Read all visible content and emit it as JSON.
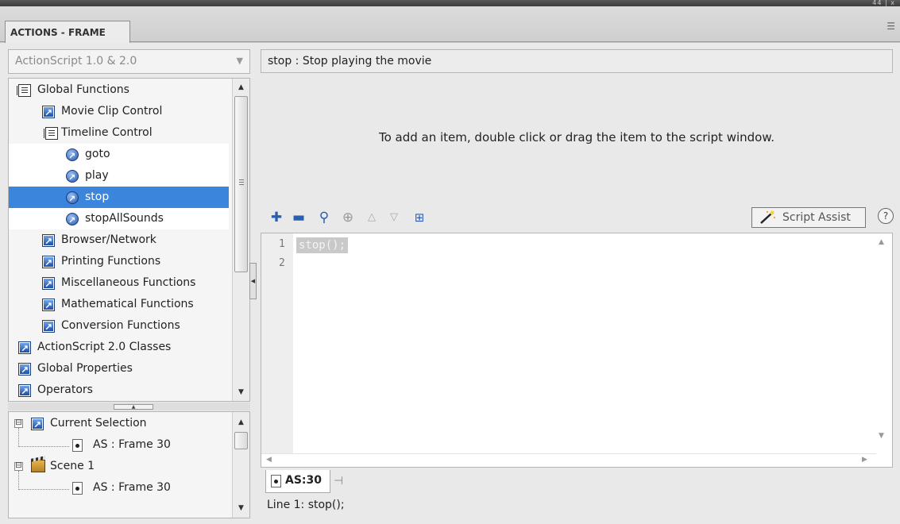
{
  "panel": {
    "tab_title": "ACTIONS - FRAME",
    "window_controls": "44 | x",
    "menu_icon": "panel-menu-icon"
  },
  "language_select": {
    "value": "ActionScript 1.0 & 2.0"
  },
  "actions_tree": {
    "items": [
      {
        "label": "Global Functions",
        "icon": "book-icon",
        "level": 0
      },
      {
        "label": "Movie Clip Control",
        "icon": "action-arrow-icon",
        "level": 1
      },
      {
        "label": "Timeline Control",
        "icon": "book-icon",
        "level": 1
      },
      {
        "label": "goto",
        "icon": "action-circle-icon",
        "level": 2
      },
      {
        "label": "play",
        "icon": "action-circle-icon",
        "level": 2
      },
      {
        "label": "stop",
        "icon": "action-circle-icon",
        "level": 2,
        "selected": true
      },
      {
        "label": "stopAllSounds",
        "icon": "action-circle-icon",
        "level": 2
      },
      {
        "label": "Browser/Network",
        "icon": "action-arrow-icon",
        "level": 1
      },
      {
        "label": "Printing Functions",
        "icon": "action-arrow-icon",
        "level": 1
      },
      {
        "label": "Miscellaneous Functions",
        "icon": "action-arrow-icon",
        "level": 1
      },
      {
        "label": "Mathematical Functions",
        "icon": "action-arrow-icon",
        "level": 1
      },
      {
        "label": "Conversion Functions",
        "icon": "action-arrow-icon",
        "level": 1
      },
      {
        "label": "ActionScript 2.0 Classes",
        "icon": "action-arrow-icon",
        "level": 0
      },
      {
        "label": "Global Properties",
        "icon": "action-arrow-icon",
        "level": 0
      },
      {
        "label": "Operators",
        "icon": "action-arrow-icon",
        "level": 0
      }
    ]
  },
  "scene_tree": {
    "items": [
      {
        "label": "Current Selection",
        "expander": "⊟"
      },
      {
        "label": "AS : Frame 30"
      },
      {
        "label": "Scene 1",
        "expander": "⊟"
      },
      {
        "label": "AS : Frame 30"
      }
    ]
  },
  "description": "stop : Stop playing the movie",
  "hint": "To add an item, double click or drag the item to the script window.",
  "toolbar": {
    "buttons": [
      "add-statement-icon",
      "delete-statement-icon",
      "find-icon",
      "target-path-icon",
      "move-up-icon",
      "move-down-icon",
      "insert-icon"
    ],
    "script_assist_label": "Script Assist",
    "help_label": "?"
  },
  "editor": {
    "lines": [
      "1",
      "2"
    ],
    "code": "stop();"
  },
  "script_tab": {
    "label": "AS:30"
  },
  "status": "Line 1: stop();",
  "colors": {
    "selection": "#3b86dc",
    "panel_bg": "#e9e9e9"
  }
}
